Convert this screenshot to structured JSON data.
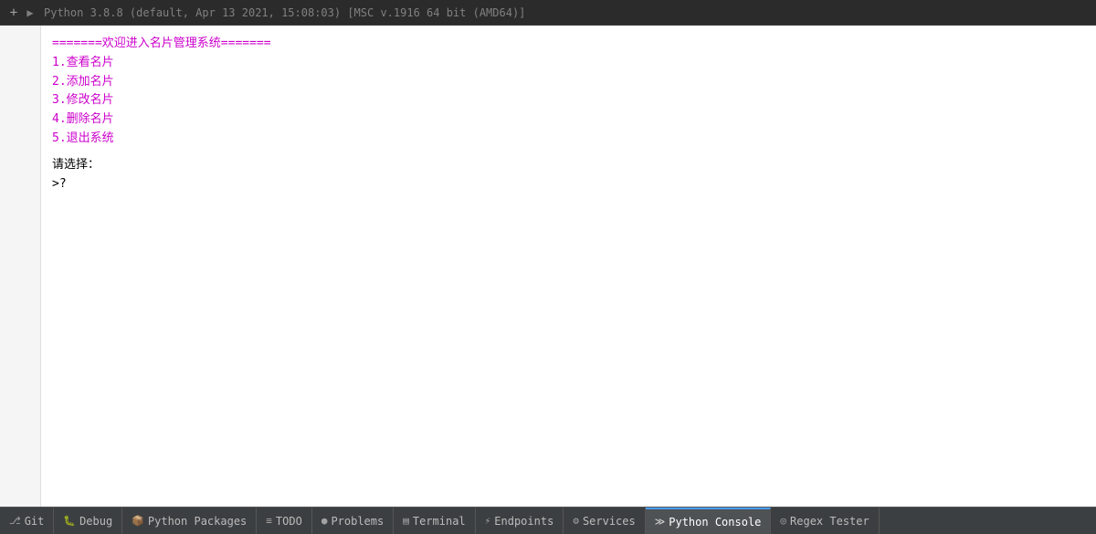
{
  "topbar": {
    "add_btn": "+",
    "run_icon": "▶",
    "console_info": "Python 3.8.8 (default, Apr 13 2021, 15:08:03) [MSC v.1916 64 bit (AMD64)]"
  },
  "console": {
    "lines": [
      {
        "text": "=======欢迎进入名片管理系统=======",
        "style": "magenta"
      },
      {
        "text": "1.查看名片",
        "style": "magenta"
      },
      {
        "text": "2.添加名片",
        "style": "magenta"
      },
      {
        "text": "3.修改名片",
        "style": "magenta"
      },
      {
        "text": "4.删除名片",
        "style": "magenta"
      },
      {
        "text": "5.退出系统",
        "style": "magenta"
      },
      {
        "text": "",
        "style": "spacer"
      },
      {
        "text": "请选择：",
        "style": "black"
      },
      {
        "text": ">?",
        "style": "black"
      }
    ]
  },
  "bottombar": {
    "tabs": [
      {
        "id": "git",
        "icon": "⎇",
        "label": "Git",
        "active": false
      },
      {
        "id": "debug",
        "icon": "🐛",
        "label": "Debug",
        "active": false
      },
      {
        "id": "python-packages",
        "icon": "📦",
        "label": "Python Packages",
        "active": false
      },
      {
        "id": "todo",
        "icon": "≡",
        "label": "TODO",
        "active": false
      },
      {
        "id": "problems",
        "icon": "●",
        "label": "Problems",
        "active": false
      },
      {
        "id": "terminal",
        "icon": "▤",
        "label": "Terminal",
        "active": false
      },
      {
        "id": "endpoints",
        "icon": "⚡",
        "label": "Endpoints",
        "active": false
      },
      {
        "id": "services",
        "icon": "⚙",
        "label": "Services",
        "active": false
      },
      {
        "id": "python-console",
        "icon": "≫",
        "label": "Python Console",
        "active": true
      },
      {
        "id": "regex-tester",
        "icon": "◎",
        "label": "Regex Tester",
        "active": false
      }
    ]
  }
}
